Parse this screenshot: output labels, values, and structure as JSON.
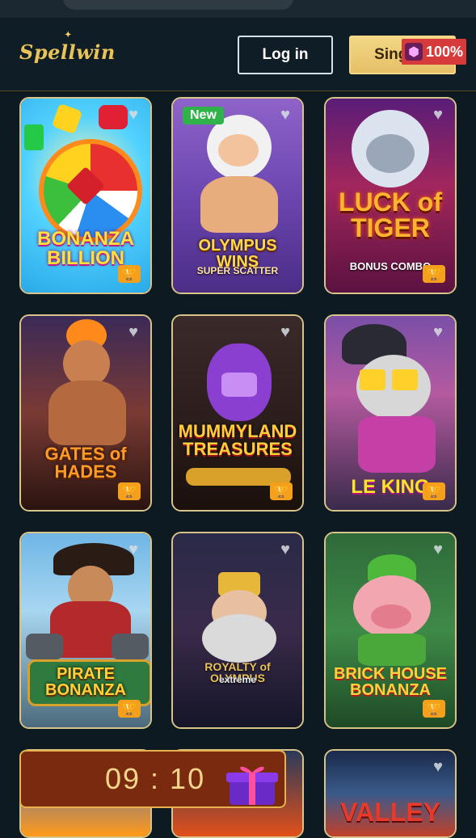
{
  "header": {
    "logo_text": "Spellwin",
    "login_label": "Log in",
    "signup_label": "Sing up",
    "promo_badge": "100%"
  },
  "games": [
    {
      "title": "BONANZA BILLION",
      "subtitle": "",
      "tag": "",
      "favorite_icon": "heart-icon",
      "trophy_icon": "trophy-icon"
    },
    {
      "title": "OLYMPUS WINS",
      "subtitle": "SUPER SCATTER",
      "tag": "New",
      "favorite_icon": "heart-icon",
      "trophy_icon": ""
    },
    {
      "title": "LUCK of TIGER",
      "subtitle": "BONUS COMBO",
      "tag": "",
      "favorite_icon": "heart-icon",
      "trophy_icon": "trophy-icon"
    },
    {
      "title": "GATES of HADES",
      "subtitle": "",
      "tag": "",
      "favorite_icon": "heart-icon",
      "trophy_icon": "trophy-icon"
    },
    {
      "title": "MUMMYLAND TREASURES",
      "subtitle": "",
      "tag": "",
      "favorite_icon": "heart-icon",
      "trophy_icon": "trophy-icon"
    },
    {
      "title": "LE KING",
      "subtitle": "",
      "tag": "",
      "favorite_icon": "heart-icon",
      "trophy_icon": "trophy-icon"
    },
    {
      "title": "PIRATE BONANZA",
      "subtitle": "",
      "tag": "",
      "favorite_icon": "heart-icon",
      "trophy_icon": "trophy-icon"
    },
    {
      "title": "ROYALTY of OLYMPUS",
      "subtitle": "extreme",
      "tag": "",
      "favorite_icon": "heart-icon",
      "trophy_icon": ""
    },
    {
      "title": "BRICK HOUSE BONANZA",
      "subtitle": "",
      "tag": "",
      "favorite_icon": "heart-icon",
      "trophy_icon": "trophy-icon"
    },
    {
      "title": "",
      "subtitle": "",
      "tag": "",
      "favorite_icon": "",
      "trophy_icon": ""
    },
    {
      "title": "",
      "subtitle": "",
      "tag": "",
      "favorite_icon": "",
      "trophy_icon": ""
    },
    {
      "title": "VALLEY",
      "subtitle": "",
      "tag": "",
      "favorite_icon": "heart-icon",
      "trophy_icon": ""
    }
  ],
  "bonus_timer": {
    "time": "09 : 10",
    "icon": "gift-box-icon"
  },
  "colors": {
    "accent_gold": "#e9c35a",
    "promo_red": "#d63a3a",
    "new_green": "#2fb24a",
    "trophy_orange": "#f4a01c"
  }
}
